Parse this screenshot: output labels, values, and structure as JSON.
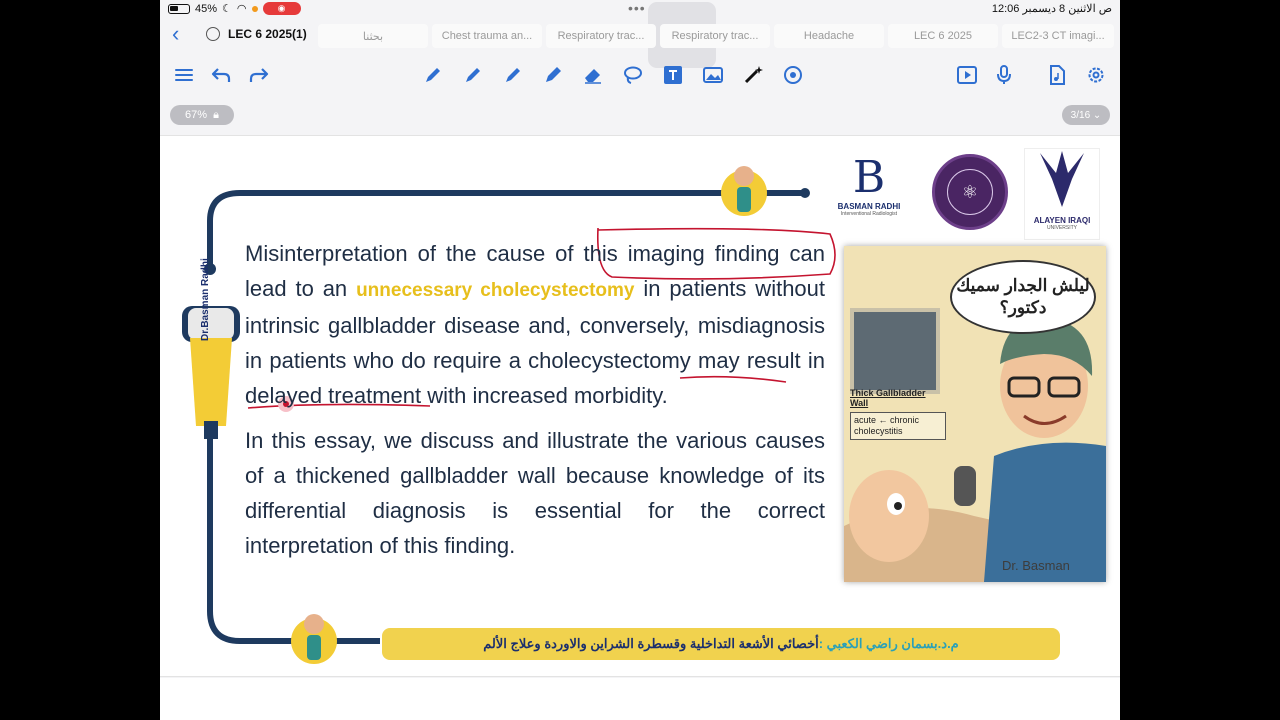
{
  "status_bar": {
    "battery": "45%",
    "clock": "12:06 ص  الاثنين 8 ديسمبر"
  },
  "tabs": {
    "current": "LEC 6 2025(1)",
    "items": [
      "بحثنا",
      "Chest trauma an...",
      "Respiratory trac...",
      "Respiratory trac...",
      "Headache",
      "LEC 6 2025",
      "LEC2-3 CT imagi..."
    ]
  },
  "view": {
    "zoom": "67%",
    "page": "3/16"
  },
  "slide": {
    "logos": {
      "basman_letter": "B",
      "basman_name": "BASMAN RADHI",
      "basman_sub": "Interventional Radiologist",
      "alayen_name": "ALAYEN IRAQI",
      "alayen_sub": "UNIVERSITY"
    },
    "probe_label": "Dr.Basman Radhi",
    "paragraph1": {
      "before": "Misinterpretation of the cause of this imaging finding can lead to an ",
      "highlight": "unnecessary cholecystectomy",
      "after": " in patients without intrinsic gallbladder disease and, conversely, misdiagnosis in patients who do require a cholecystectomy may result in delayed treatment with increased morbidity."
    },
    "paragraph2": "In this essay, we discuss and illustrate the various causes of a thickened gallbladder wall because knowledge of its differential diagnosis is essential for the correct interpretation of this finding.",
    "cartoon": {
      "speech": "ليلش الجدار سميك دكتور؟",
      "us_title": "Thick Gallbladder Wall",
      "us_note": "acute ← chronic cholecystitis",
      "signature": "Dr. Basman"
    },
    "footer": {
      "name": "م.د.بسمان راضي الكعبي :",
      "title": " أخصائي الأشعة التداخلية وقسطرة الشراين والاوردة وعلاج الألم"
    }
  },
  "colors": {
    "accent": "#2f6fd1",
    "ink_red": "#c4142f",
    "frame": "#1e3a5f",
    "highlight": "#e7bf1c"
  }
}
